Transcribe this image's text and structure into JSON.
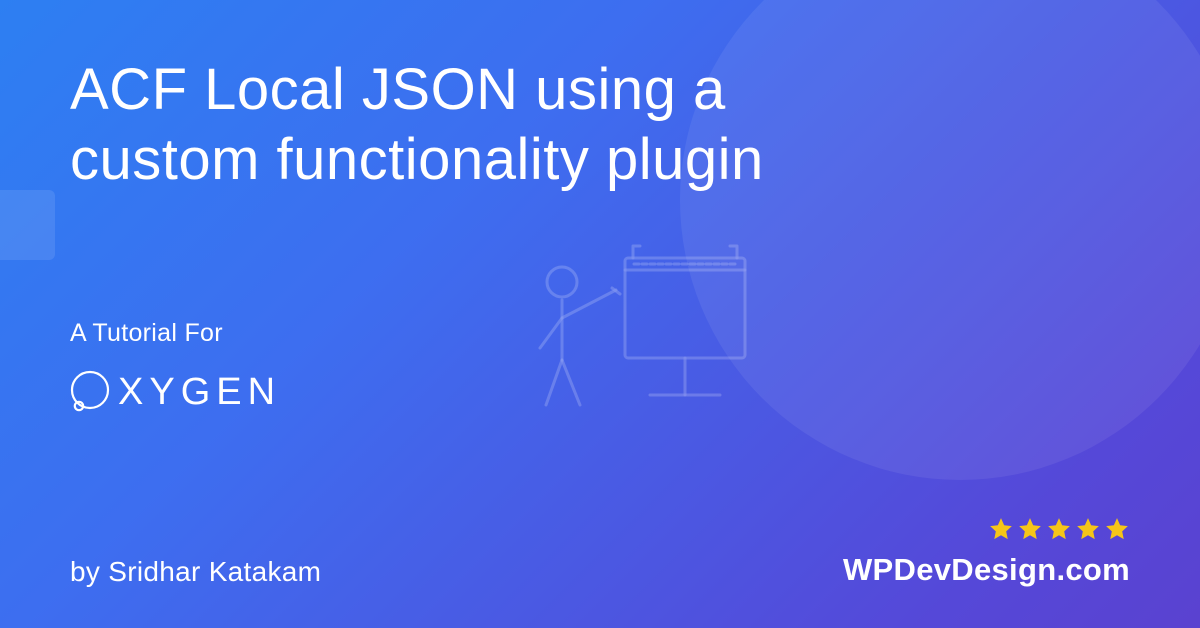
{
  "title": "ACF Local JSON using a custom functionality plugin",
  "subtitle": "A Tutorial For",
  "brand": "OXYGEN",
  "byline": "by Sridhar Katakam",
  "site": "WPDevDesign.com",
  "stars": 5,
  "colors": {
    "star": "#f5c518"
  }
}
